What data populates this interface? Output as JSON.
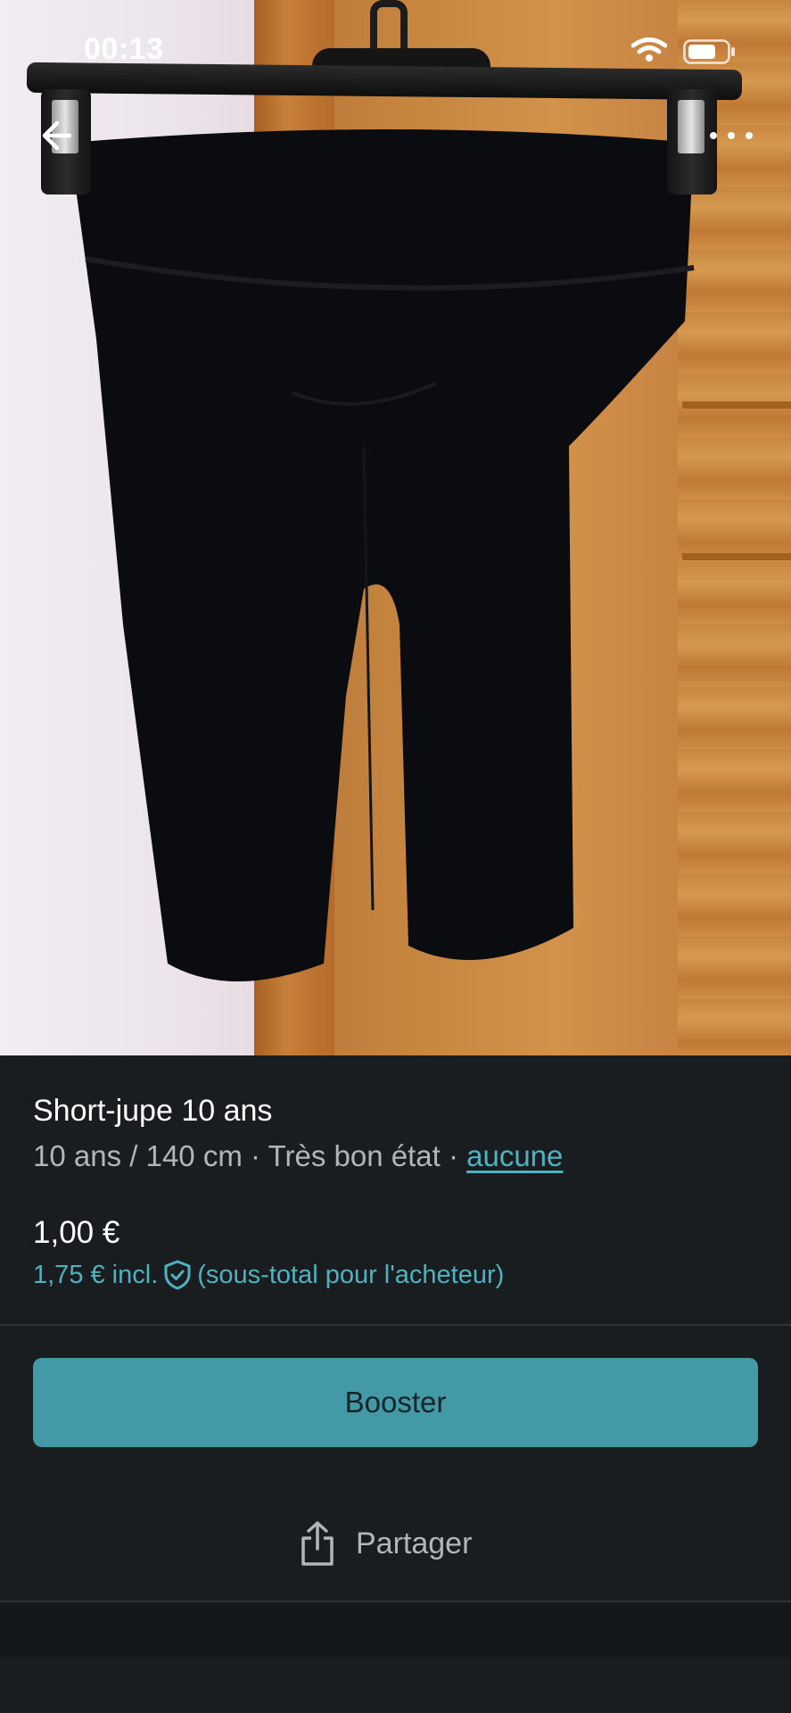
{
  "status_bar": {
    "time": "00:13"
  },
  "listing": {
    "title": "Short-jupe 10 ans",
    "size": "10 ans / 140 cm",
    "separator": "·",
    "condition": "Très bon état",
    "brand_link": "aucune",
    "price": "1,00 €",
    "price_incl": "1,75 € incl.",
    "price_incl_note": "(sous-total pour l'acheteur)"
  },
  "actions": {
    "booster_label": "Booster",
    "share_label": "Partager"
  },
  "colors": {
    "accent": "#4fb2c0",
    "button_bg": "#4499a6",
    "background": "#1a1d1f"
  },
  "icons": {
    "back": "arrow-left-icon",
    "more": "more-horizontal-icon",
    "wifi": "wifi-icon",
    "battery": "battery-icon",
    "shield": "shield-check-icon",
    "share": "share-icon"
  }
}
